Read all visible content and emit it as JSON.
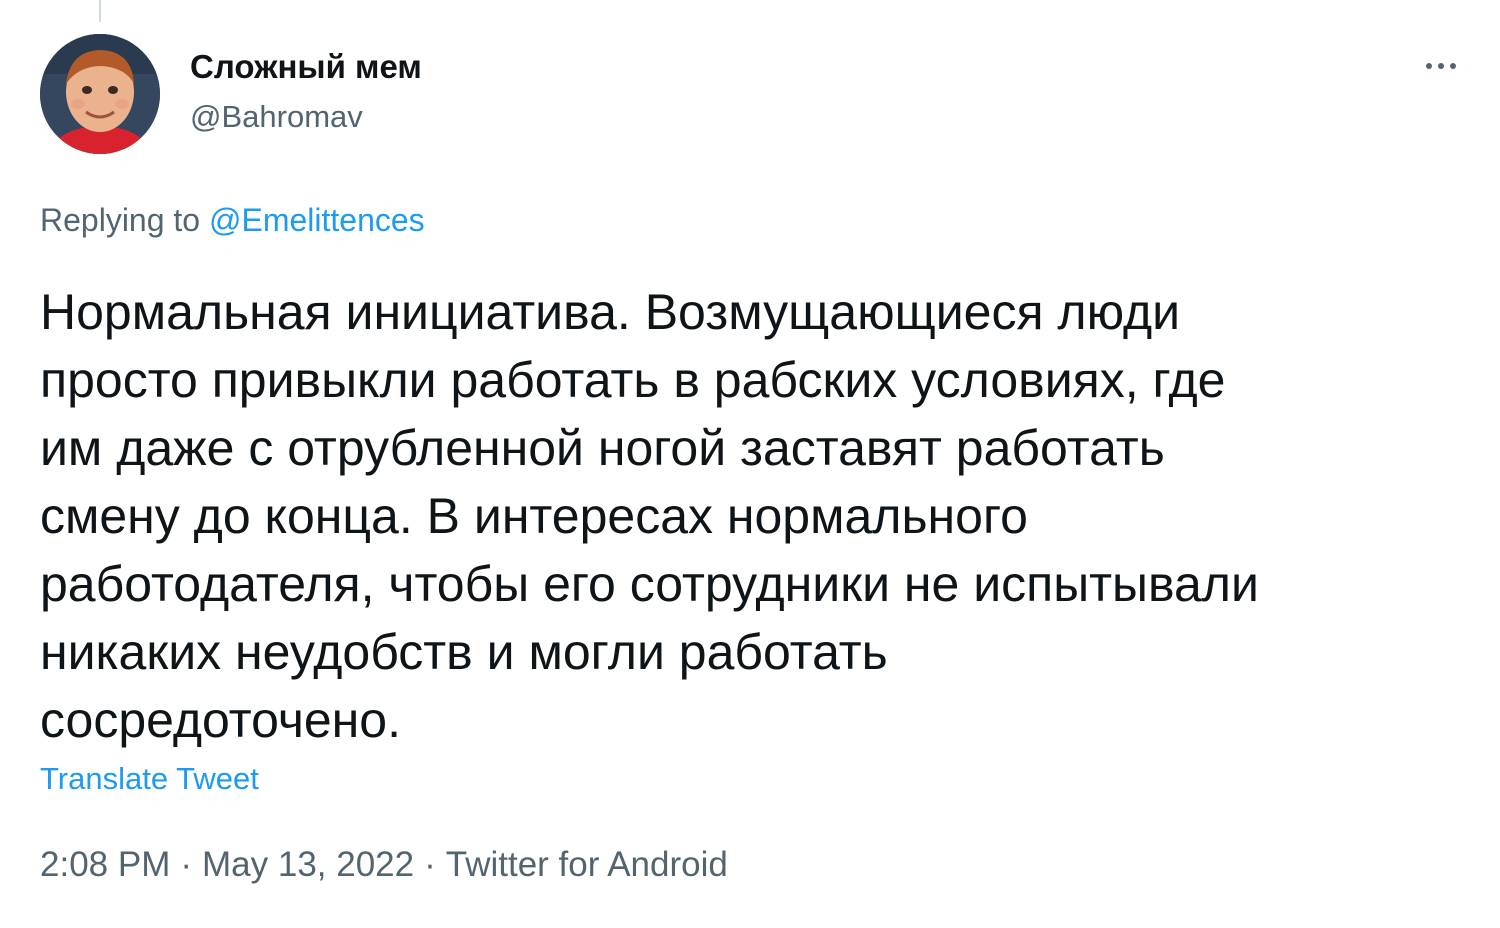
{
  "tweet": {
    "author": {
      "display_name": "Сложный мем",
      "handle": "@Bahromav",
      "avatar_icon": "child-portrait-avatar"
    },
    "more_icon": "more-horizontal-icon",
    "replying_to": {
      "prefix": "Replying to",
      "mention": "@Emelittences"
    },
    "text_lines": [
      "Нормальная инициатива. Возмущающиеся люди",
      "просто привыкли работать в рабских условиях, где",
      "им даже с отрубленной ногой заставят работать",
      "смену до конца. В интересах нормального",
      "работодателя, чтобы его сотрудники не испытывали",
      "никаких неудобств и могли работать",
      "сосредоточено."
    ],
    "translate_label": "Translate Tweet",
    "meta": {
      "time": "2:08 PM",
      "date": "May 13, 2022",
      "separator": "·",
      "source": "Twitter for Android"
    }
  },
  "colors": {
    "text_primary": "#0f1419",
    "text_secondary": "#536471",
    "link": "#1d9bf0"
  }
}
